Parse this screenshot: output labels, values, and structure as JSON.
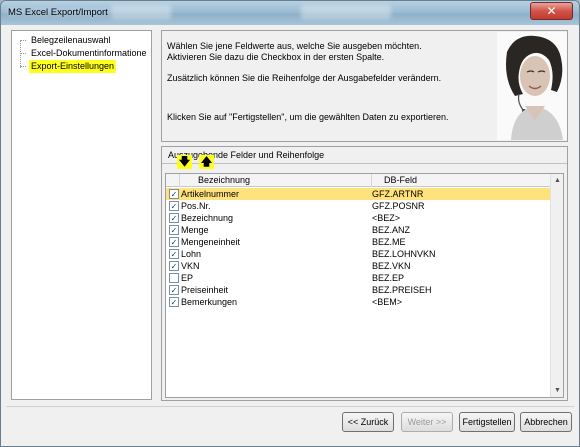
{
  "window": {
    "title": "MS Excel Export/Import",
    "close_label": "✕"
  },
  "tree": {
    "items": [
      {
        "label": "Belegzeilenauswahl",
        "selected": false
      },
      {
        "label": "Excel-Dokumentinformatione",
        "selected": false
      },
      {
        "label": "Export-Einstellungen",
        "selected": true
      }
    ]
  },
  "info": {
    "line1": "Wählen Sie jene Feldwerte aus, welche Sie ausgeben möchten.",
    "line2": "Aktivieren Sie dazu die Checkbox in der ersten Spalte.",
    "line3": "Zusätzlich können Sie die Reihenfolge der Ausgabefelder verändern.",
    "line4": "Klicken Sie auf \"Fertigstellen\", um die gewählten Daten zu exportieren."
  },
  "group": {
    "title": "Auszugebende Felder und Reihenfolge",
    "move_down_icon": "arrow-down-icon",
    "move_up_icon": "arrow-up-icon",
    "move_down_glyph": "🡇",
    "move_up_glyph": "🡅"
  },
  "grid": {
    "columns": [
      "Bezeichnung",
      "DB-Feld"
    ],
    "rows": [
      {
        "checked": true,
        "name": "Artikelnummer",
        "db": "GFZ.ARTNR",
        "selected": true
      },
      {
        "checked": true,
        "name": "Pos.Nr.",
        "db": "GFZ.POSNR",
        "selected": false
      },
      {
        "checked": true,
        "name": "Bezeichnung",
        "db": "<BEZ>",
        "selected": false
      },
      {
        "checked": true,
        "name": "Menge",
        "db": "BEZ.ANZ",
        "selected": false
      },
      {
        "checked": true,
        "name": "Mengeneinheit",
        "db": "BEZ.ME",
        "selected": false
      },
      {
        "checked": true,
        "name": "Lohn",
        "db": "BEZ.LOHNVKN",
        "selected": false
      },
      {
        "checked": true,
        "name": "VKN",
        "db": "BEZ.VKN",
        "selected": false
      },
      {
        "checked": false,
        "name": "EP",
        "db": "BEZ.EP",
        "selected": false
      },
      {
        "checked": true,
        "name": "Preiseinheit",
        "db": "BEZ.PREISEH",
        "selected": false
      },
      {
        "checked": true,
        "name": "Bemerkungen",
        "db": "<BEM>",
        "selected": false
      }
    ]
  },
  "buttons": {
    "back": "<< Zurück",
    "next": "Weiter >>",
    "finish": "Fertigstellen",
    "cancel": "Abbrechen"
  },
  "colors": {
    "highlight": "#ffff1e",
    "row_selected": "#ffe27c"
  }
}
